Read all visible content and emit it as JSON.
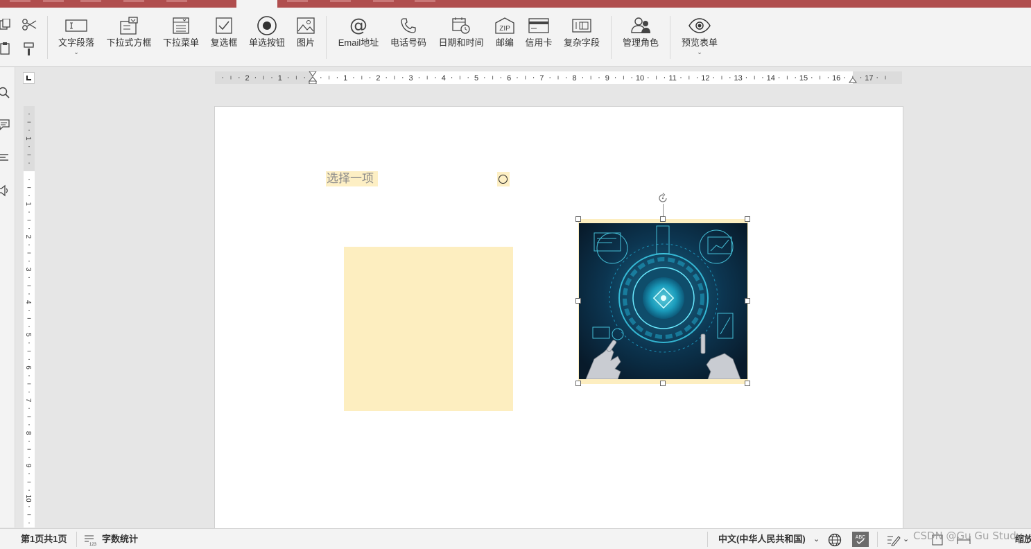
{
  "ribbon": {
    "buttons": [
      {
        "label": "文字段落",
        "icon": "text-paragraph-icon",
        "dropdown": true
      },
      {
        "label": "下拉式方框",
        "icon": "dropdown-box-icon"
      },
      {
        "label": "下拉菜单",
        "icon": "dropdown-menu-icon"
      },
      {
        "label": "复选框",
        "icon": "checkbox-icon"
      },
      {
        "label": "单选按钮",
        "icon": "radio-button-icon"
      },
      {
        "label": "图片",
        "icon": "picture-icon"
      },
      {
        "label": "Email地址",
        "icon": "at-sign-icon"
      },
      {
        "label": "电话号码",
        "icon": "phone-icon"
      },
      {
        "label": "日期和时间",
        "icon": "calendar-clock-icon"
      },
      {
        "label": "邮编",
        "icon": "zip-icon"
      },
      {
        "label": "信用卡",
        "icon": "credit-card-icon"
      },
      {
        "label": "复杂字段",
        "icon": "complex-field-icon"
      },
      {
        "label": "管理角色",
        "icon": "manage-roles-icon"
      },
      {
        "label": "预览表单",
        "icon": "eye-icon",
        "dropdown": true
      }
    ],
    "zip_text": "ZIP"
  },
  "ruler": {
    "horizontal_labels": [
      "2",
      "1",
      "1",
      "2",
      "3",
      "4",
      "5",
      "6",
      "7",
      "8",
      "9",
      "10",
      "11",
      "12",
      "13",
      "14",
      "15",
      "16",
      "17"
    ],
    "vertical_labels": [
      "1",
      "1",
      "2",
      "3",
      "4",
      "5",
      "6",
      "7",
      "8",
      "9",
      "10"
    ]
  },
  "document": {
    "dropdown_placeholder": "选择一项"
  },
  "statusbar": {
    "page_info": "第1页共1页",
    "word_count": "字数统计",
    "language": "中文(中华人民共和国)",
    "zoom_label": "缩放"
  },
  "watermark": "CSDN @Gu Gu Study",
  "colors": {
    "title_bar": "#b04e4e",
    "content_control_fill": "#fdeec0",
    "ribbon_bg": "#f3f3f3"
  }
}
